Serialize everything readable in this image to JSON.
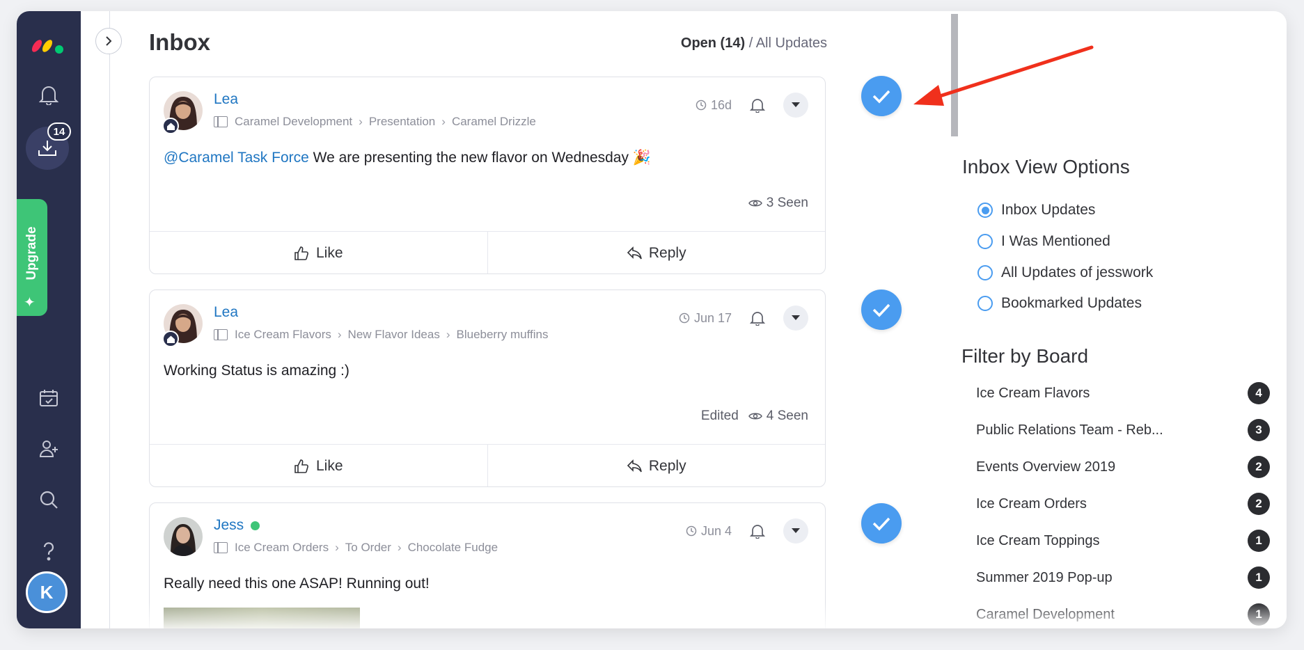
{
  "nav": {
    "inbox_badge": "14",
    "upgrade_label": "Upgrade",
    "avatar_initial": "K"
  },
  "header": {
    "title": "Inbox",
    "filter_open": "Open (14)",
    "filter_divider": " / ",
    "filter_all": "All Updates"
  },
  "cards": [
    {
      "author": "Lea",
      "crumbs": [
        "Caramel Development",
        "Presentation",
        "Caramel Drizzle"
      ],
      "time": "16d",
      "mention": "@Caramel Task Force",
      "text": " We are presenting the new flavor on Wednesday 🎉",
      "edited": "",
      "seen": "3 Seen",
      "like_label": "Like",
      "reply_label": "Reply"
    },
    {
      "author": "Lea",
      "crumbs": [
        "Ice Cream Flavors",
        "New Flavor Ideas",
        "Blueberry muffins"
      ],
      "time": "Jun 17",
      "mention": "",
      "text": "Working Status is amazing :)",
      "edited": "Edited",
      "seen": "4 Seen",
      "like_label": "Like",
      "reply_label": "Reply"
    },
    {
      "author": "Jess",
      "crumbs": [
        "Ice Cream Orders",
        "To Order",
        "Chocolate Fudge"
      ],
      "time": "Jun 4",
      "mention": "",
      "text": "Really need this one ASAP! Running out!",
      "edited": "",
      "seen": "",
      "like_label": "",
      "reply_label": ""
    }
  ],
  "view_options": {
    "title": "Inbox View Options",
    "options": [
      {
        "label": "Inbox Updates",
        "checked": true
      },
      {
        "label": "I Was Mentioned",
        "checked": false
      },
      {
        "label": "All Updates of jesswork",
        "checked": false
      },
      {
        "label": "Bookmarked Updates",
        "checked": false
      }
    ]
  },
  "filter_board": {
    "title": "Filter by Board",
    "boards": [
      {
        "name": "Ice Cream Flavors",
        "count": "4"
      },
      {
        "name": "Public Relations Team - Reb...",
        "count": "3"
      },
      {
        "name": "Events Overview 2019",
        "count": "2"
      },
      {
        "name": "Ice Cream Orders",
        "count": "2"
      },
      {
        "name": "Ice Cream Toppings",
        "count": "1"
      },
      {
        "name": "Summer 2019 Pop-up",
        "count": "1"
      },
      {
        "name": "Caramel Development",
        "count": "1"
      }
    ]
  },
  "colors": {
    "nav_bg": "#292f4c",
    "accent_blue": "#4a9cf0",
    "link_blue": "#1f76c2",
    "upgrade_green": "#3ec577",
    "arrow_red": "#f0301c"
  }
}
